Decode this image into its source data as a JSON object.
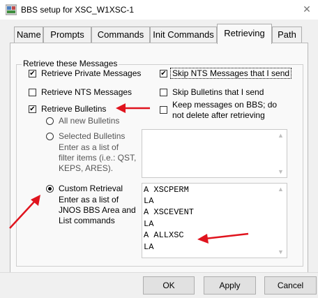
{
  "window": {
    "title": "BBS setup for XSC_W1XSC-1",
    "close_glyph": "✕",
    "app_icon": "bbs-app-icon"
  },
  "tabs": [
    {
      "label": "Name",
      "active": false
    },
    {
      "label": "Prompts",
      "active": false
    },
    {
      "label": "Commands",
      "active": false
    },
    {
      "label": "Init Commands",
      "active": false
    },
    {
      "label": "Retrieving",
      "active": true
    },
    {
      "label": "Path",
      "active": false
    }
  ],
  "group": {
    "legend": "Retrieve these Messages",
    "retrieve_private": {
      "label": "Retrieve Private Messages",
      "checked": true
    },
    "retrieve_nts": {
      "label": "Retrieve NTS Messages",
      "checked": false
    },
    "retrieve_bulletins": {
      "label": "Retrieve Bulletins",
      "checked": true
    },
    "skip_nts": {
      "label": "Skip NTS Messages that I send",
      "checked": true
    },
    "skip_bulletins": {
      "label": "Skip Bulletins that I send",
      "checked": false
    },
    "keep_messages": {
      "label_line1": "Keep messages on BBS; do",
      "label_line2": "not delete after retrieving",
      "checked": false
    },
    "all_new": {
      "label": "All new Bulletins",
      "selected": false
    },
    "selected_bulletins": {
      "label": "Selected Bulletins",
      "selected": false,
      "help_lines": [
        "Enter as a list of",
        "filter items (i.e.: QST,",
        "KEPS, ARES)."
      ],
      "text": ""
    },
    "custom_retrieval": {
      "label": "Custom Retrieval",
      "selected": true,
      "help_lines": [
        "Enter as a list of",
        "JNOS BBS Area and",
        "List commands"
      ],
      "lines": [
        "A XSCPERM",
        "LA",
        "A XSCEVENT",
        "LA",
        "A ALLXSC",
        "LA"
      ]
    }
  },
  "buttons": {
    "ok": "OK",
    "apply": "Apply",
    "cancel": "Cancel"
  },
  "colors": {
    "annotation_arrow": "#e0141e",
    "dialog_bg": "#f0f0f0",
    "panel_bg": "#f9f9f9"
  },
  "icons": {
    "scroll_up": "▲",
    "scroll_down": "▼",
    "checkmark": "✔"
  }
}
